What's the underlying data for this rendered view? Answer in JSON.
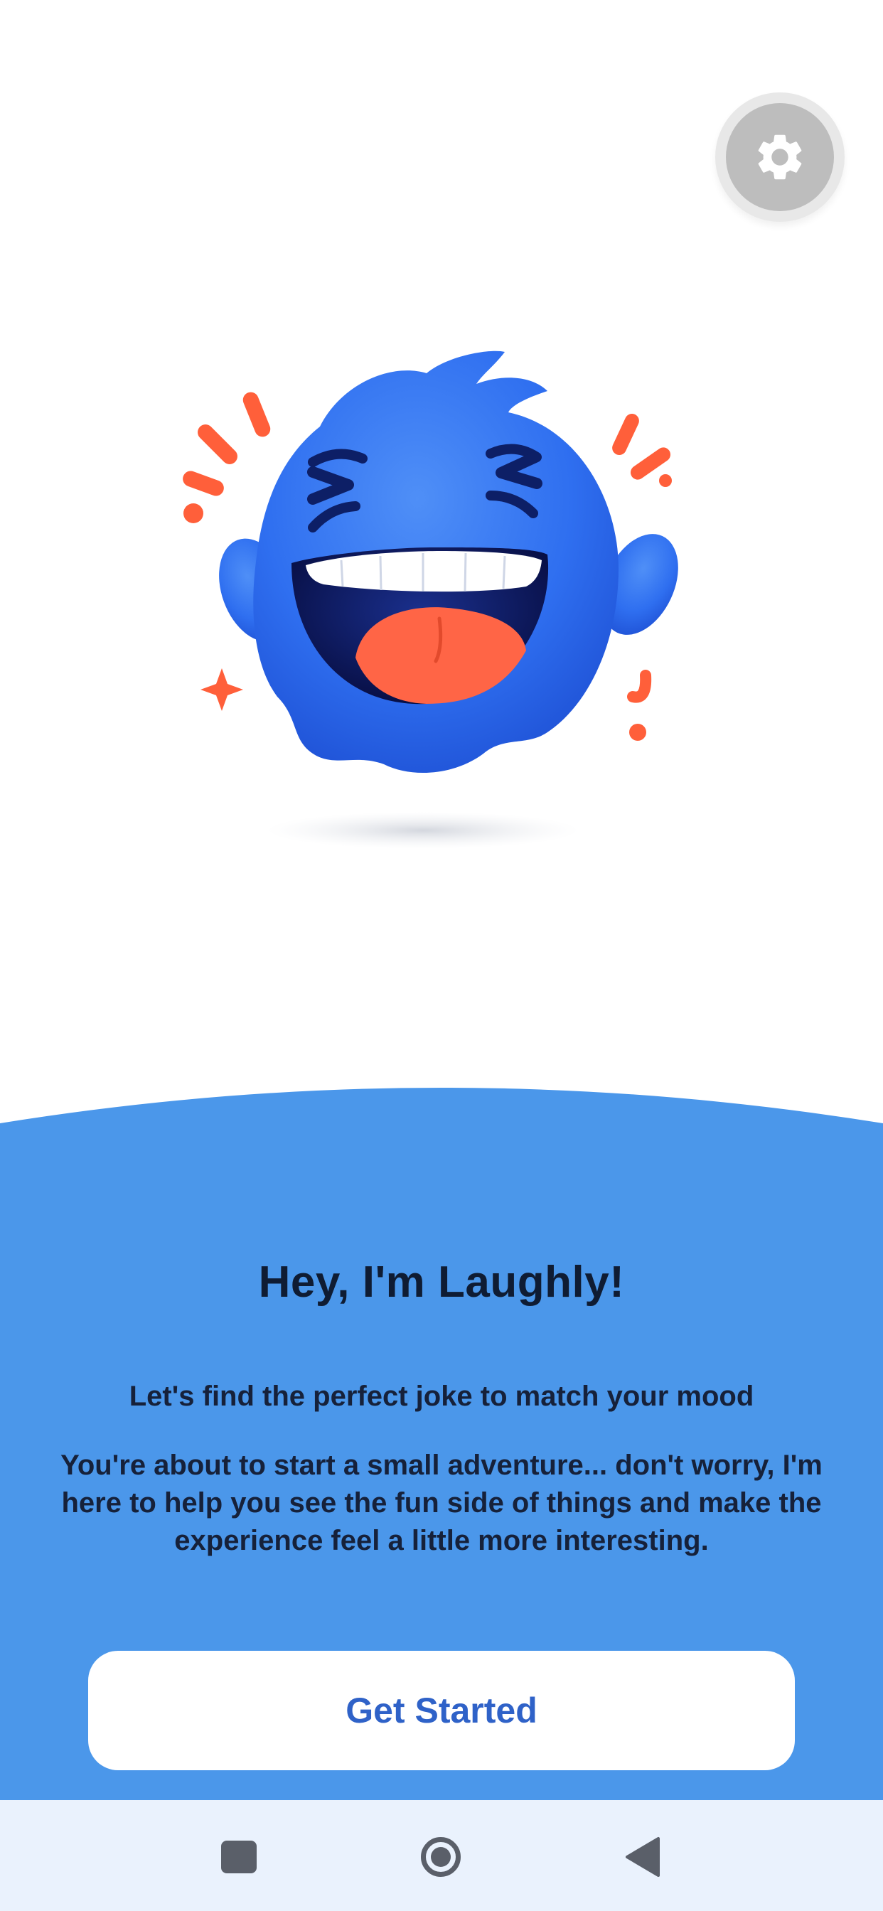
{
  "app": {
    "name": "Laughly",
    "accent_color": "#4b97ea",
    "button_text_color": "#2f62c8",
    "mascot_color": "#2f72f0"
  },
  "header": {
    "settings_icon": "gear-icon"
  },
  "welcome": {
    "headline": "Hey, I'm Laughly!",
    "subtitle": "Let's find the perfect joke to match your mood",
    "body": "You're about to start a small adventure... don't worry, I'm here to help you see the fun side of things and make the experience feel a little more interesting.",
    "cta_label": "Get Started"
  },
  "system_nav": {
    "recents_icon": "square-icon",
    "home_icon": "circle-icon",
    "back_icon": "triangle-back-icon"
  }
}
